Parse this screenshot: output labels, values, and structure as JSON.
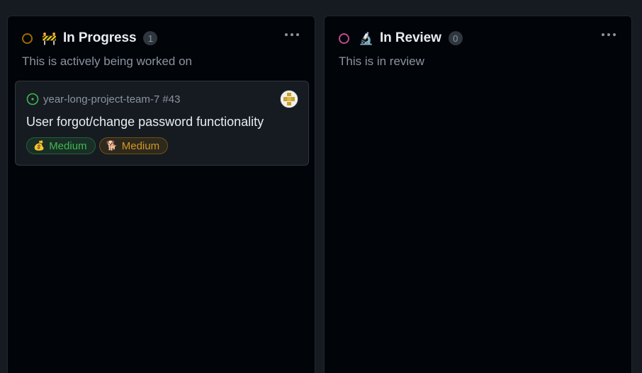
{
  "colors": {
    "page_bg": "#161b22",
    "column_bg": "#010409",
    "in_progress_ring": "#9e6a03",
    "in_review_ring": "#bf4b8a",
    "open_issue": "#3fb950",
    "label_green": "#3fb950",
    "label_orange": "#d29922"
  },
  "columns": [
    {
      "emoji": "🚧",
      "title": "In Progress",
      "count": "1",
      "description": "This is actively being worked on",
      "menu_icon": "kebab-horizontal-icon",
      "cards": [
        {
          "status_icon": "issue-opened-icon",
          "repo": "year-long-project-team-7 #43",
          "title": "User forgot/change password functionality",
          "assignee_icon": "identicon-avatar",
          "labels": [
            {
              "emoji": "💰",
              "text": "Medium"
            },
            {
              "emoji": "🐕",
              "text": "Medium"
            }
          ]
        }
      ]
    },
    {
      "emoji": "🔬",
      "title": "In Review",
      "count": "0",
      "description": "This is in review",
      "menu_icon": "kebab-horizontal-icon",
      "cards": []
    }
  ]
}
